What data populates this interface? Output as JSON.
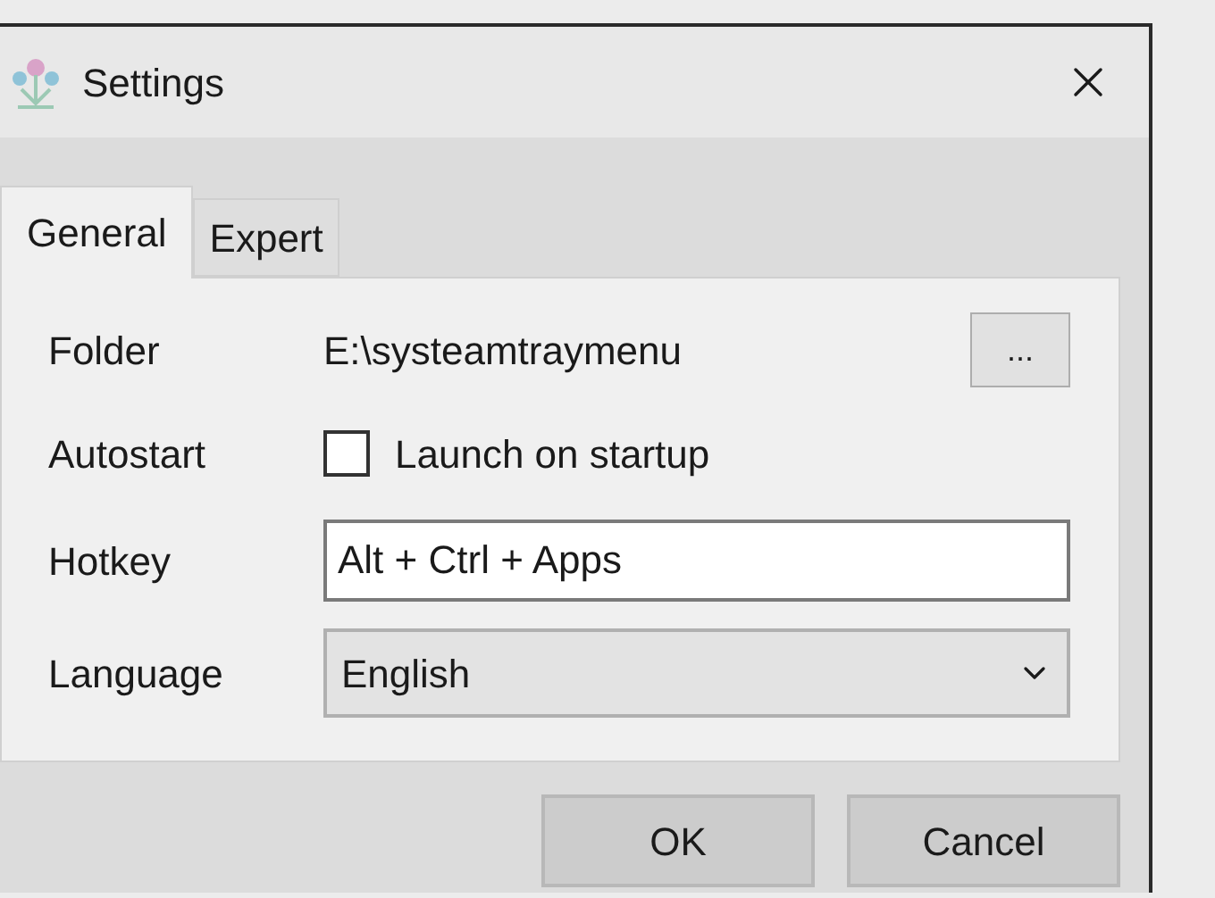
{
  "window": {
    "title": "Settings"
  },
  "tabs": [
    {
      "label": "General",
      "selected": true
    },
    {
      "label": "Expert",
      "selected": false
    }
  ],
  "folder": {
    "label": "Folder",
    "value": "E:\\systeamtraymenu",
    "browse_button": "..."
  },
  "autostart": {
    "label": "Autostart",
    "checkbox": {
      "label": "Launch on startup",
      "checked": false
    }
  },
  "hotkey": {
    "label": "Hotkey",
    "value": "Alt + Ctrl + Apps"
  },
  "language": {
    "label": "Language",
    "value": "English"
  },
  "buttons": [
    "OK",
    "Cancel"
  ]
}
